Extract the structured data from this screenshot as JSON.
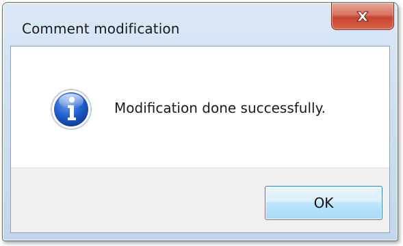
{
  "dialog": {
    "title": "Comment modification",
    "message": "Modification done successfully.",
    "icon": "info-icon",
    "close_glyph": "x-icon",
    "ok_label": "OK"
  },
  "colors": {
    "close_button": "#c7442c",
    "ok_button": "#bee6fd",
    "ok_border": "#3c7fb1",
    "info_icon_blue": "#1e56c4"
  }
}
